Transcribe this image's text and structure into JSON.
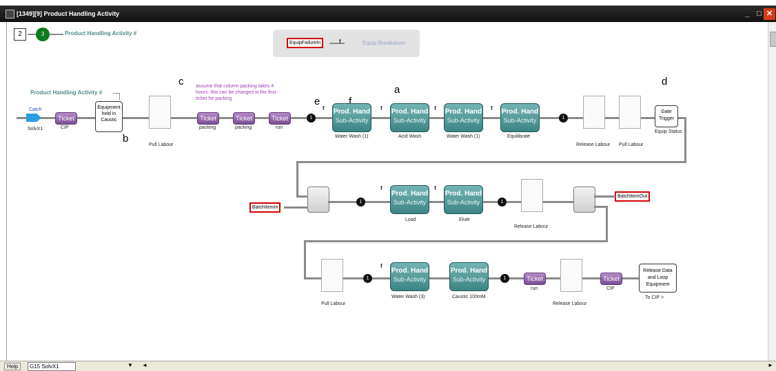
{
  "window": {
    "title": "[1349][9]  Product Handling Activity",
    "min_icon": "minimize-icon",
    "max_icon": "maximize-icon",
    "close_icon": "close-icon"
  },
  "top": {
    "counter_value": "2",
    "node_number": "3",
    "activity_label": "Product Handling Activity #"
  },
  "equip_panel": {
    "input_label": "EquipFailureIn",
    "f_mark": "f",
    "breakdown_label": "Equip Breakdown"
  },
  "flow_label": "Product Handling Activity #",
  "annotation": "assume that column packing takes 4 hours. this can be changed in the first ticket for packing",
  "letters": {
    "a": "a",
    "b": "b",
    "c": "c",
    "d": "d",
    "e": "e",
    "f": "f"
  },
  "row1": {
    "catch_label": "Catch",
    "solvx1_label": "SolvX1",
    "ticket_text": "Ticket",
    "cip_label": "CIP",
    "equipment_box": "Equipment held in Caustic",
    "pull_labour": "Pull Labour",
    "packing1": "packing",
    "packing2": "packing",
    "run": "run",
    "token": "1",
    "sub_title": "Prod. Hand",
    "sub_sub": "Sub-Activity",
    "water_wash": "Water Wash (1)",
    "acid_wash": "Acid Wash",
    "water_wash2": "Water Wash (1)",
    "equilibrate": "Equilibrate",
    "release_labour": "Release Labour",
    "pull_labour2": "Pull Labour",
    "gate_trigger": "Gate Trigger",
    "equip_status": "Equip Status"
  },
  "row2": {
    "batch_in": "BatchItemIn",
    "batch_out": "BatchItemOut",
    "load": "Load",
    "elute": "Elute",
    "release_labour": "Release Labour"
  },
  "row3": {
    "pull_labour": "Pull Labour",
    "water_wash3": "Water Wash (3)",
    "caustic": "Caustic 100mM",
    "run": "run",
    "release_labour": "Release Labour",
    "cip": "CIP",
    "release_box": "Release Data and Loop Equipment",
    "to_cip": "To CIP >"
  },
  "status": {
    "help": "Help",
    "combo_value": "G15 SolvX1"
  }
}
